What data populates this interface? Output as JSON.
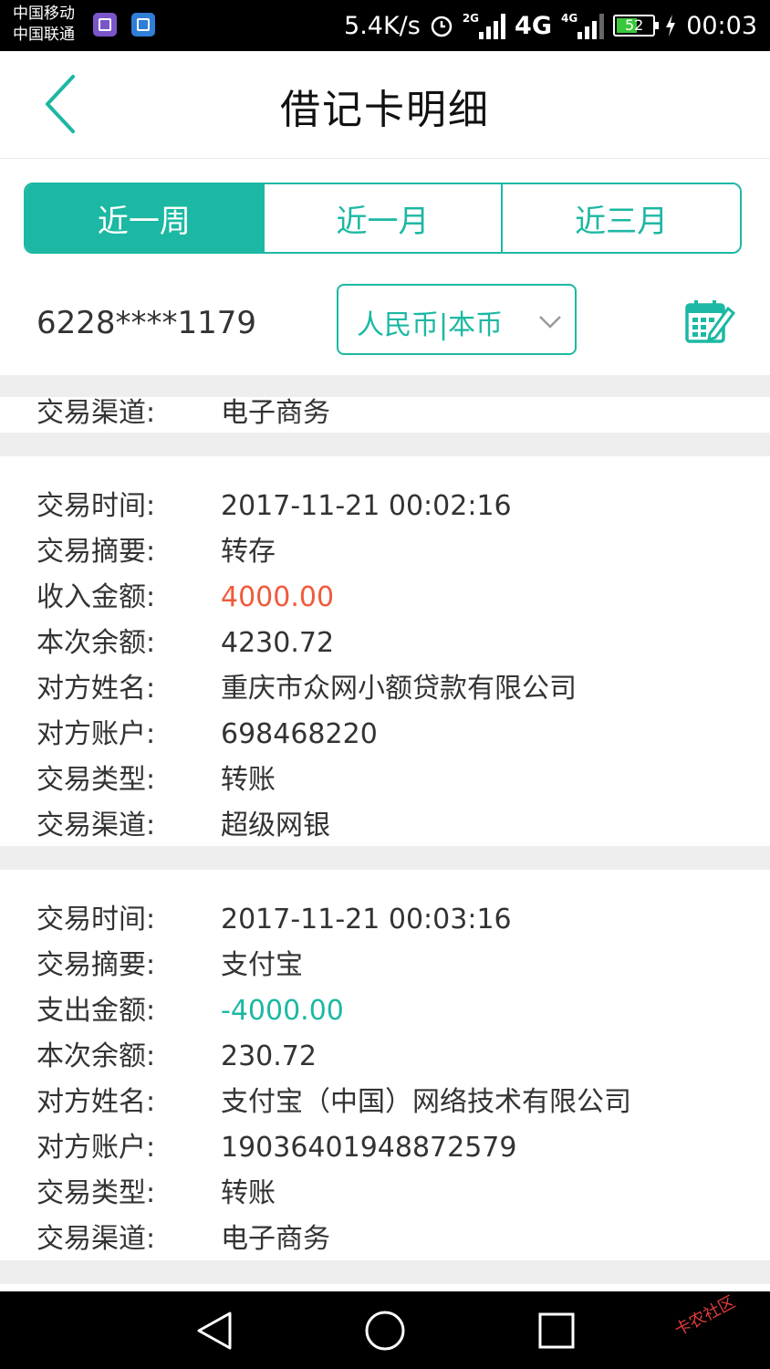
{
  "status_bar": {
    "carrier_1": "中国移动",
    "carrier_2": "中国联通",
    "net_speed": "5.4K/s",
    "sig_2g": "2G",
    "net_4g_1": "4G",
    "net_4g_2": "4G",
    "battery": "52",
    "time": "00:03"
  },
  "header": {
    "title": "借记卡明细"
  },
  "tabs": [
    {
      "label": "近一周",
      "active": true
    },
    {
      "label": "近一月",
      "active": false
    },
    {
      "label": "近三月",
      "active": false
    }
  ],
  "account": {
    "card_number": "6228****1179",
    "currency_selected": "人民币|本币"
  },
  "records": [
    {
      "partial": true,
      "fields": [
        {
          "key": "交易渠道:",
          "value": "电子商务"
        }
      ]
    },
    {
      "fields": [
        {
          "key": "交易时间:",
          "value": "2017-11-21 00:02:16"
        },
        {
          "key": "交易摘要:",
          "value": "转存"
        },
        {
          "key": "收入金额:",
          "value": "4000.00",
          "tone": "income"
        },
        {
          "key": "本次余额:",
          "value": "4230.72"
        },
        {
          "key": "对方姓名:",
          "value": "重庆市众网小额贷款有限公司"
        },
        {
          "key": "对方账户:",
          "value": "698468220"
        },
        {
          "key": "交易类型:",
          "value": "转账"
        },
        {
          "key": "交易渠道:",
          "value": "超级网银"
        }
      ]
    },
    {
      "fields": [
        {
          "key": "交易时间:",
          "value": "2017-11-21 00:03:16"
        },
        {
          "key": "交易摘要:",
          "value": "支付宝"
        },
        {
          "key": "支出金额:",
          "value": "-4000.00",
          "tone": "expense"
        },
        {
          "key": "本次余额:",
          "value": "230.72"
        },
        {
          "key": "对方姓名:",
          "value": "支付宝（中国）网络技术有限公司"
        },
        {
          "key": "对方账户:",
          "value": "19036401948872579"
        },
        {
          "key": "交易类型:",
          "value": "转账"
        },
        {
          "key": "交易渠道:",
          "value": "电子商务"
        }
      ]
    }
  ],
  "watermark": "卡农社区",
  "colors": {
    "accent": "#1cb8a3",
    "income": "#f05a3a",
    "text": "#333333",
    "separator": "#eeeeee"
  },
  "icons": {
    "back": "chevron-left-icon",
    "currency_dropdown": "chevron-down-icon",
    "calendar": "calendar-edit-icon",
    "nav_back": "triangle-back-icon",
    "nav_home": "circle-home-icon",
    "nav_recent": "square-recent-icon"
  }
}
